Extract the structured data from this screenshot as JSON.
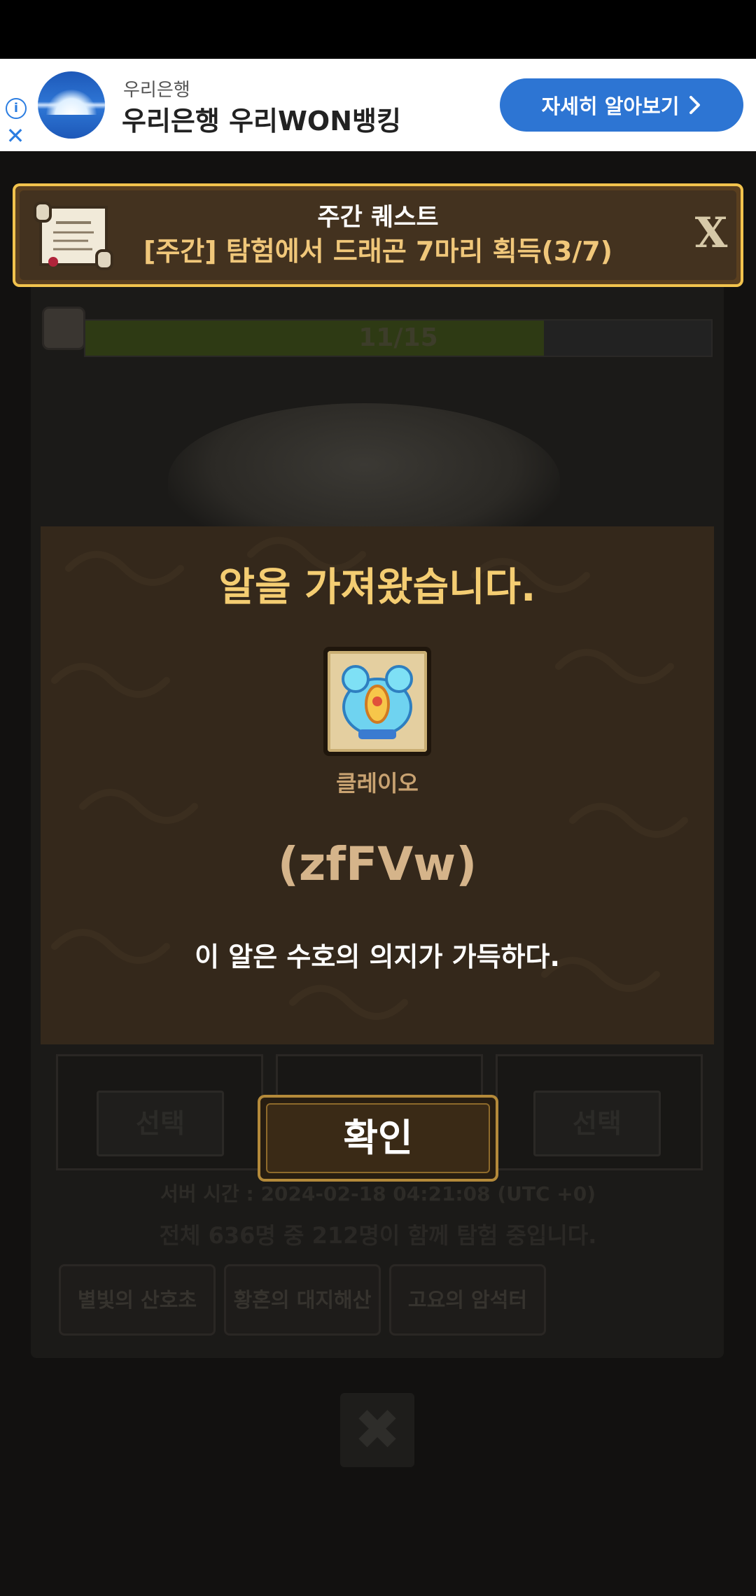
{
  "ad": {
    "brand": "우리은행",
    "title": "우리은행 우리WON뱅킹",
    "cta": "자세히 알아보기",
    "info_icon": "info-icon",
    "close_icon": "close-icon"
  },
  "quest": {
    "title": "주간 퀘스트",
    "description": "[주간] 탐험에서 드래곤 7마리 획득(3/7)",
    "close_label": "X"
  },
  "background": {
    "progress_text": "11/15",
    "progress_value": 0.733,
    "select_left": "선택",
    "select_right": "선택",
    "server_time": "서버 시간 : 2024-02-18 04:21:08 (UTC +0)",
    "players": "전체 636명 중 212명이 함께 탐험 중입니다.",
    "chips": [
      "별빛의 산호초",
      "황혼의 대지해산",
      "고요의 암석터"
    ],
    "close_label": "✖"
  },
  "dialog": {
    "title": "알을 가져왔습니다.",
    "item_name": "클레이오",
    "item_code": "(zfFVw)",
    "description": "이 알은 수호의 의지가 가득하다.",
    "confirm": "확인"
  },
  "colors": {
    "accent_gold": "#f4cd72",
    "ad_blue": "#2d75d3"
  }
}
